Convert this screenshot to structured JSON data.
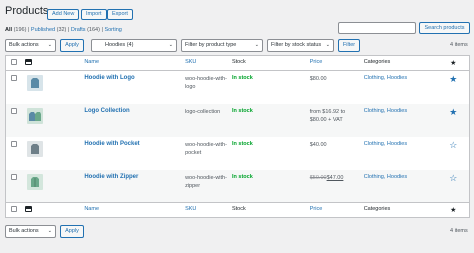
{
  "header": {
    "title": "Products",
    "add_new": "Add New",
    "import": "Import",
    "export": "Export"
  },
  "subsubsub": {
    "all": "All",
    "all_count": "(196)",
    "published": "Published",
    "published_count": "(32)",
    "drafts": "Drafts",
    "drafts_count": "(164)",
    "sorting": "Sorting",
    "sep": "|"
  },
  "search": {
    "placeholder": "",
    "button": "Search products"
  },
  "filters": {
    "bulk_actions": "Bulk actions",
    "apply": "Apply",
    "category": "Hoodies  (4)",
    "product_type": "Filter by product type",
    "stock_status": "Filter by stock status",
    "filter": "Filter",
    "items_count": "4 items"
  },
  "columns": {
    "name": "Name",
    "sku": "SKU",
    "stock": "Stock",
    "price": "Price",
    "categories": "Categories",
    "featured": "★"
  },
  "rows": [
    {
      "name": "Hoodie with Logo",
      "sku": "woo-hoodie-with-logo",
      "stock": "In stock",
      "price": "$80.00",
      "categories": "Clothing, Hoodies",
      "featured": "★",
      "thumb_color": "#d7e4ea"
    },
    {
      "name": "Logo Collection",
      "sku": "logo-collection",
      "stock": "In stock",
      "price": "from $16.92 to $80.00 + VAT",
      "categories": "Clothing, Hoodies",
      "featured": "★",
      "thumb_color": "#cfe3d9"
    },
    {
      "name": "Hoodie with Pocket",
      "sku": "woo-hoodie-with-pocket",
      "stock": "In stock",
      "price": "$40.00",
      "categories": "Clothing, Hoodies",
      "featured": "☆",
      "thumb_color": "#dfe4e6"
    },
    {
      "name": "Hoodie with Zipper",
      "sku": "woo-hoodie-with-zipper",
      "stock": "In stock",
      "price_regular": "$50.00",
      "price_sale": "$47.00",
      "categories": "Clothing, Hoodies",
      "featured": "☆",
      "thumb_color": "#d3e6dc"
    }
  ],
  "colors": {
    "accent": "#2271b1",
    "in_stock": "#00a32a",
    "background": "#f0f0f1"
  }
}
